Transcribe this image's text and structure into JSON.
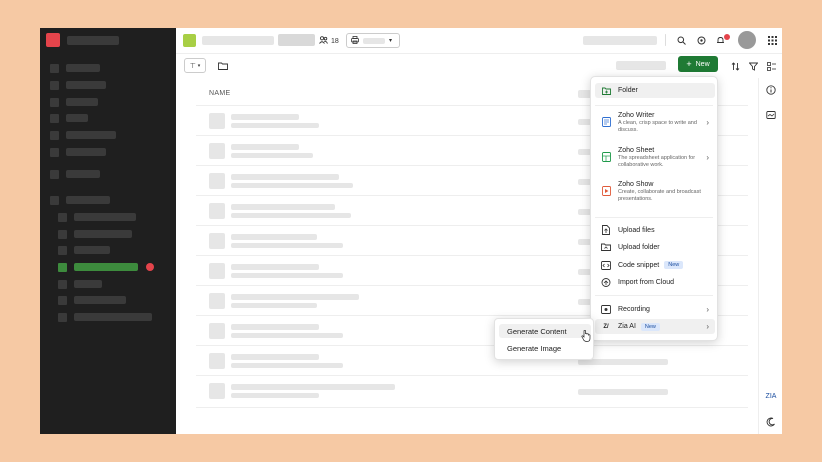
{
  "topbar": {
    "members_count": "18"
  },
  "toolbar": {
    "new_label": "New"
  },
  "table": {
    "name_header": "NAME"
  },
  "menu": {
    "folder": "Folder",
    "writer_title": "Zoho Writer",
    "writer_desc": "A clean, crisp space to write and discuss.",
    "sheet_title": "Zoho Sheet",
    "sheet_desc": "The spreadsheet application for collaborative work.",
    "show_title": "Zoho Show",
    "show_desc": "Create, collaborate and broadcast presentations.",
    "upload_files": "Upload files",
    "upload_folder": "Upload folder",
    "code_snippet": "Code snippet",
    "code_snippet_badge": "New",
    "import_cloud": "Import from Cloud",
    "recording": "Recording",
    "zia_ai": "Zia AI",
    "zia_ai_badge": "New"
  },
  "submenu": {
    "generate_content": "Generate Content",
    "generate_image": "Generate Image"
  },
  "colors": {
    "accent_green": "#1f7a34",
    "sidebar_bg": "#1f1f1f",
    "brand_red": "#e4444b",
    "background": "#f6c9a4"
  },
  "icons": [
    "logo-icon",
    "people-icon",
    "search-icon",
    "help-icon",
    "bell-icon",
    "apps-icon",
    "folder-icon",
    "sort-icon",
    "filter-icon",
    "view-icon",
    "info-icon",
    "activity-icon",
    "zia-icon",
    "moon-icon",
    "pointer-cursor-icon"
  ]
}
